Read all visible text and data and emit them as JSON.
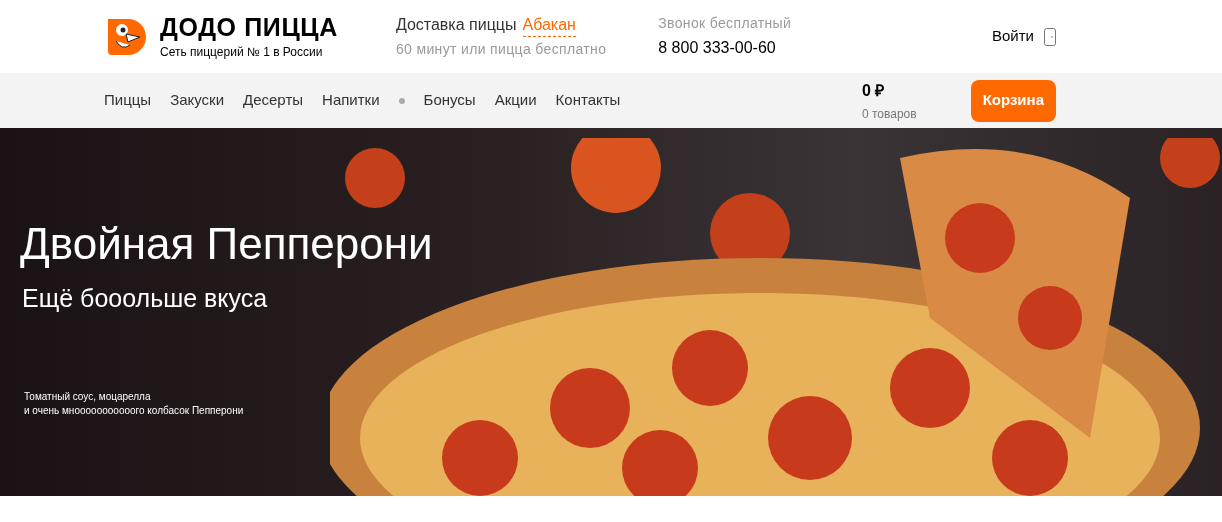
{
  "header": {
    "brand": "ДОДО ПИЦЦА",
    "tagline": "Сеть пиццерий № 1 в России",
    "delivery_label": "Доставка пиццы",
    "city": "Абакан",
    "delivery_note": "60 минут или пицца бесплатно",
    "call_label": "Звонок бесплатный",
    "phone": "8 800 333-00-60",
    "login": "Войти"
  },
  "nav": {
    "items": [
      {
        "kind": "link",
        "label": "Пиццы"
      },
      {
        "kind": "link",
        "label": "Закуски"
      },
      {
        "kind": "link",
        "label": "Десерты"
      },
      {
        "kind": "link",
        "label": "Напитки"
      },
      {
        "kind": "separator"
      },
      {
        "kind": "link",
        "label": "Бонусы"
      },
      {
        "kind": "link",
        "label": "Акции"
      },
      {
        "kind": "link",
        "label": "Контакты"
      }
    ],
    "cart_total": "0 ₽",
    "cart_count": "0 товаров",
    "cart_button": "Корзина"
  },
  "banner": {
    "title": "Двойная Пепперони",
    "subtitle": "Ещё бооольше вкуса",
    "description_lines": [
      "Томатный соус, моцарелла",
      "и очень мнооооооооооого колбасок Пепперони"
    ]
  }
}
